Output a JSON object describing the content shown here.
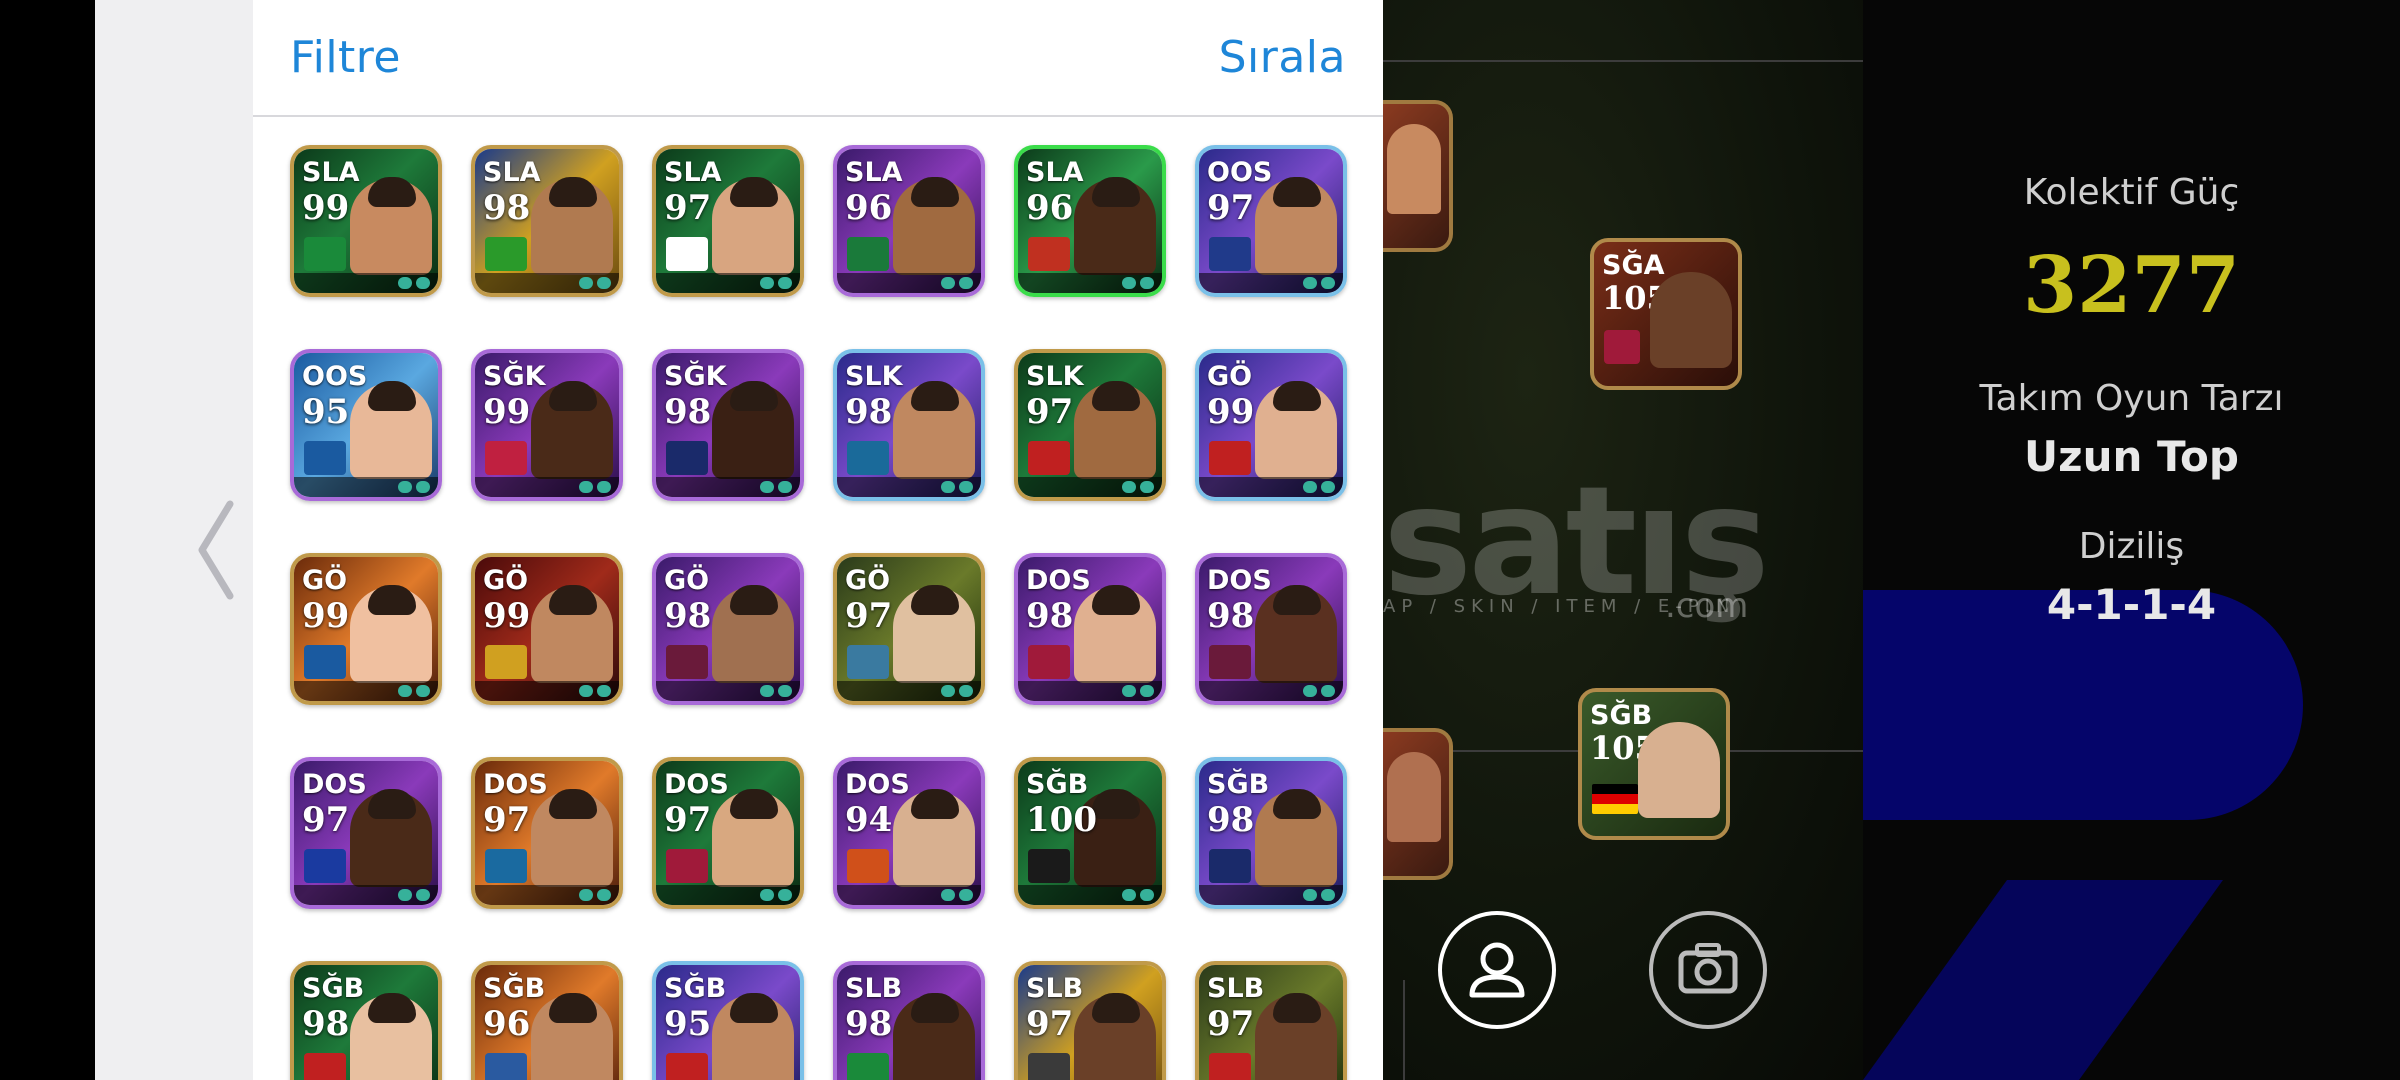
{
  "panel": {
    "filter_label": "Filtre",
    "sort_label": "Sırala"
  },
  "cards": [
    {
      "pos": "SLA",
      "rating": "99",
      "theme": "green",
      "face": "#c88a60",
      "badge": "#1a8a3a"
    },
    {
      "pos": "SLA",
      "rating": "98",
      "theme": "gold",
      "face": "#b07a50",
      "badge": "#2a9a2a"
    },
    {
      "pos": "SLA",
      "rating": "97",
      "theme": "green",
      "face": "#d8a580",
      "badge": "#ffffff"
    },
    {
      "pos": "SLA",
      "rating": "96",
      "theme": "purple",
      "face": "#a06a40",
      "badge": "#1a7a3a"
    },
    {
      "pos": "SLA",
      "rating": "96",
      "theme": "greenBright",
      "face": "#4a2a18",
      "badge": "#c03020"
    },
    {
      "pos": "OOS",
      "rating": "97",
      "theme": "purpleBlue",
      "face": "#c08860",
      "badge": "#203a8a"
    },
    {
      "pos": "OOS",
      "rating": "95",
      "theme": "blue",
      "face": "#e8b898",
      "badge": "#1a5aa0"
    },
    {
      "pos": "SĞK",
      "rating": "99",
      "theme": "purple",
      "face": "#4a2a18",
      "badge": "#c02040"
    },
    {
      "pos": "SĞK",
      "rating": "98",
      "theme": "purple",
      "face": "#3a2014",
      "badge": "#1a2a6a"
    },
    {
      "pos": "SLK",
      "rating": "98",
      "theme": "purpleBlue",
      "face": "#c08860",
      "badge": "#1a6a9a"
    },
    {
      "pos": "SLK",
      "rating": "97",
      "theme": "green",
      "face": "#a06a40",
      "badge": "#c02020"
    },
    {
      "pos": "GÖ",
      "rating": "99",
      "theme": "purpleBlue",
      "face": "#e0b090",
      "badge": "#c02020"
    },
    {
      "pos": "GÖ",
      "rating": "99",
      "theme": "orange",
      "face": "#f0c0a0",
      "badge": "#1a5aa0"
    },
    {
      "pos": "GÖ",
      "rating": "99",
      "theme": "redGold",
      "face": "#c08860",
      "badge": "#d0a020"
    },
    {
      "pos": "GÖ",
      "rating": "98",
      "theme": "purple",
      "face": "#a07050",
      "badge": "#6a1a3a"
    },
    {
      "pos": "GÖ",
      "rating": "97",
      "theme": "greenGold",
      "face": "#e0c0a0",
      "badge": "#3a7aa0"
    },
    {
      "pos": "DOS",
      "rating": "98",
      "theme": "purple",
      "face": "#e0b090",
      "badge": "#a01a3a"
    },
    {
      "pos": "DOS",
      "rating": "98",
      "theme": "purple",
      "face": "#5a3020",
      "badge": "#6a1a3a"
    },
    {
      "pos": "DOS",
      "rating": "97",
      "theme": "purple",
      "face": "#4a2a18",
      "badge": "#1a3aa0"
    },
    {
      "pos": "DOS",
      "rating": "97",
      "theme": "orange",
      "face": "#c08860",
      "badge": "#1a6aa0"
    },
    {
      "pos": "DOS",
      "rating": "97",
      "theme": "green",
      "face": "#d8a880",
      "badge": "#a01a3a"
    },
    {
      "pos": "DOS",
      "rating": "94",
      "theme": "purple",
      "face": "#d8b090",
      "badge": "#d0501a"
    },
    {
      "pos": "SĞB",
      "rating": "100",
      "theme": "green",
      "face": "#3a2014",
      "badge": "#1a1a1a"
    },
    {
      "pos": "SĞB",
      "rating": "98",
      "theme": "purpleBlue",
      "face": "#b07a50",
      "badge": "#1a2a6a"
    },
    {
      "pos": "SĞB",
      "rating": "98",
      "theme": "green",
      "face": "#e8c0a0",
      "badge": "#c02020"
    },
    {
      "pos": "SĞB",
      "rating": "96",
      "theme": "orange",
      "face": "#c08860",
      "badge": "#2a5aa0"
    },
    {
      "pos": "SĞB",
      "rating": "95",
      "theme": "purpleBlue",
      "face": "#c08860",
      "badge": "#c02020"
    },
    {
      "pos": "SLB",
      "rating": "98",
      "theme": "purple",
      "face": "#4a2a18",
      "badge": "#1a8a3a"
    },
    {
      "pos": "SLB",
      "rating": "97",
      "theme": "gold",
      "face": "#6a4028",
      "badge": "#3a3a3a"
    },
    {
      "pos": "SLB",
      "rating": "97",
      "theme": "greenGold",
      "face": "#6a4028",
      "badge": "#c02020"
    }
  ],
  "pitch": {
    "watermark": "satış",
    "watermark_sub": "AP / SKIN / ITEM / E-PIN",
    "watermark_com": ".com",
    "players": [
      {
        "pos": "SĞA",
        "rating": "105"
      },
      {
        "pos": "SĞB",
        "rating": "105"
      }
    ]
  },
  "stats": {
    "collective_label": "Kolektif Güç",
    "collective_value": "3277",
    "style_label": "Takım Oyun Tarzı",
    "style_value": "Uzun Top",
    "formation_label": "Diziliş",
    "formation_value": "4-1-1-4",
    "colors": {
      "collective": "#c8c01e",
      "accent_blue": "#1e86d8"
    }
  }
}
